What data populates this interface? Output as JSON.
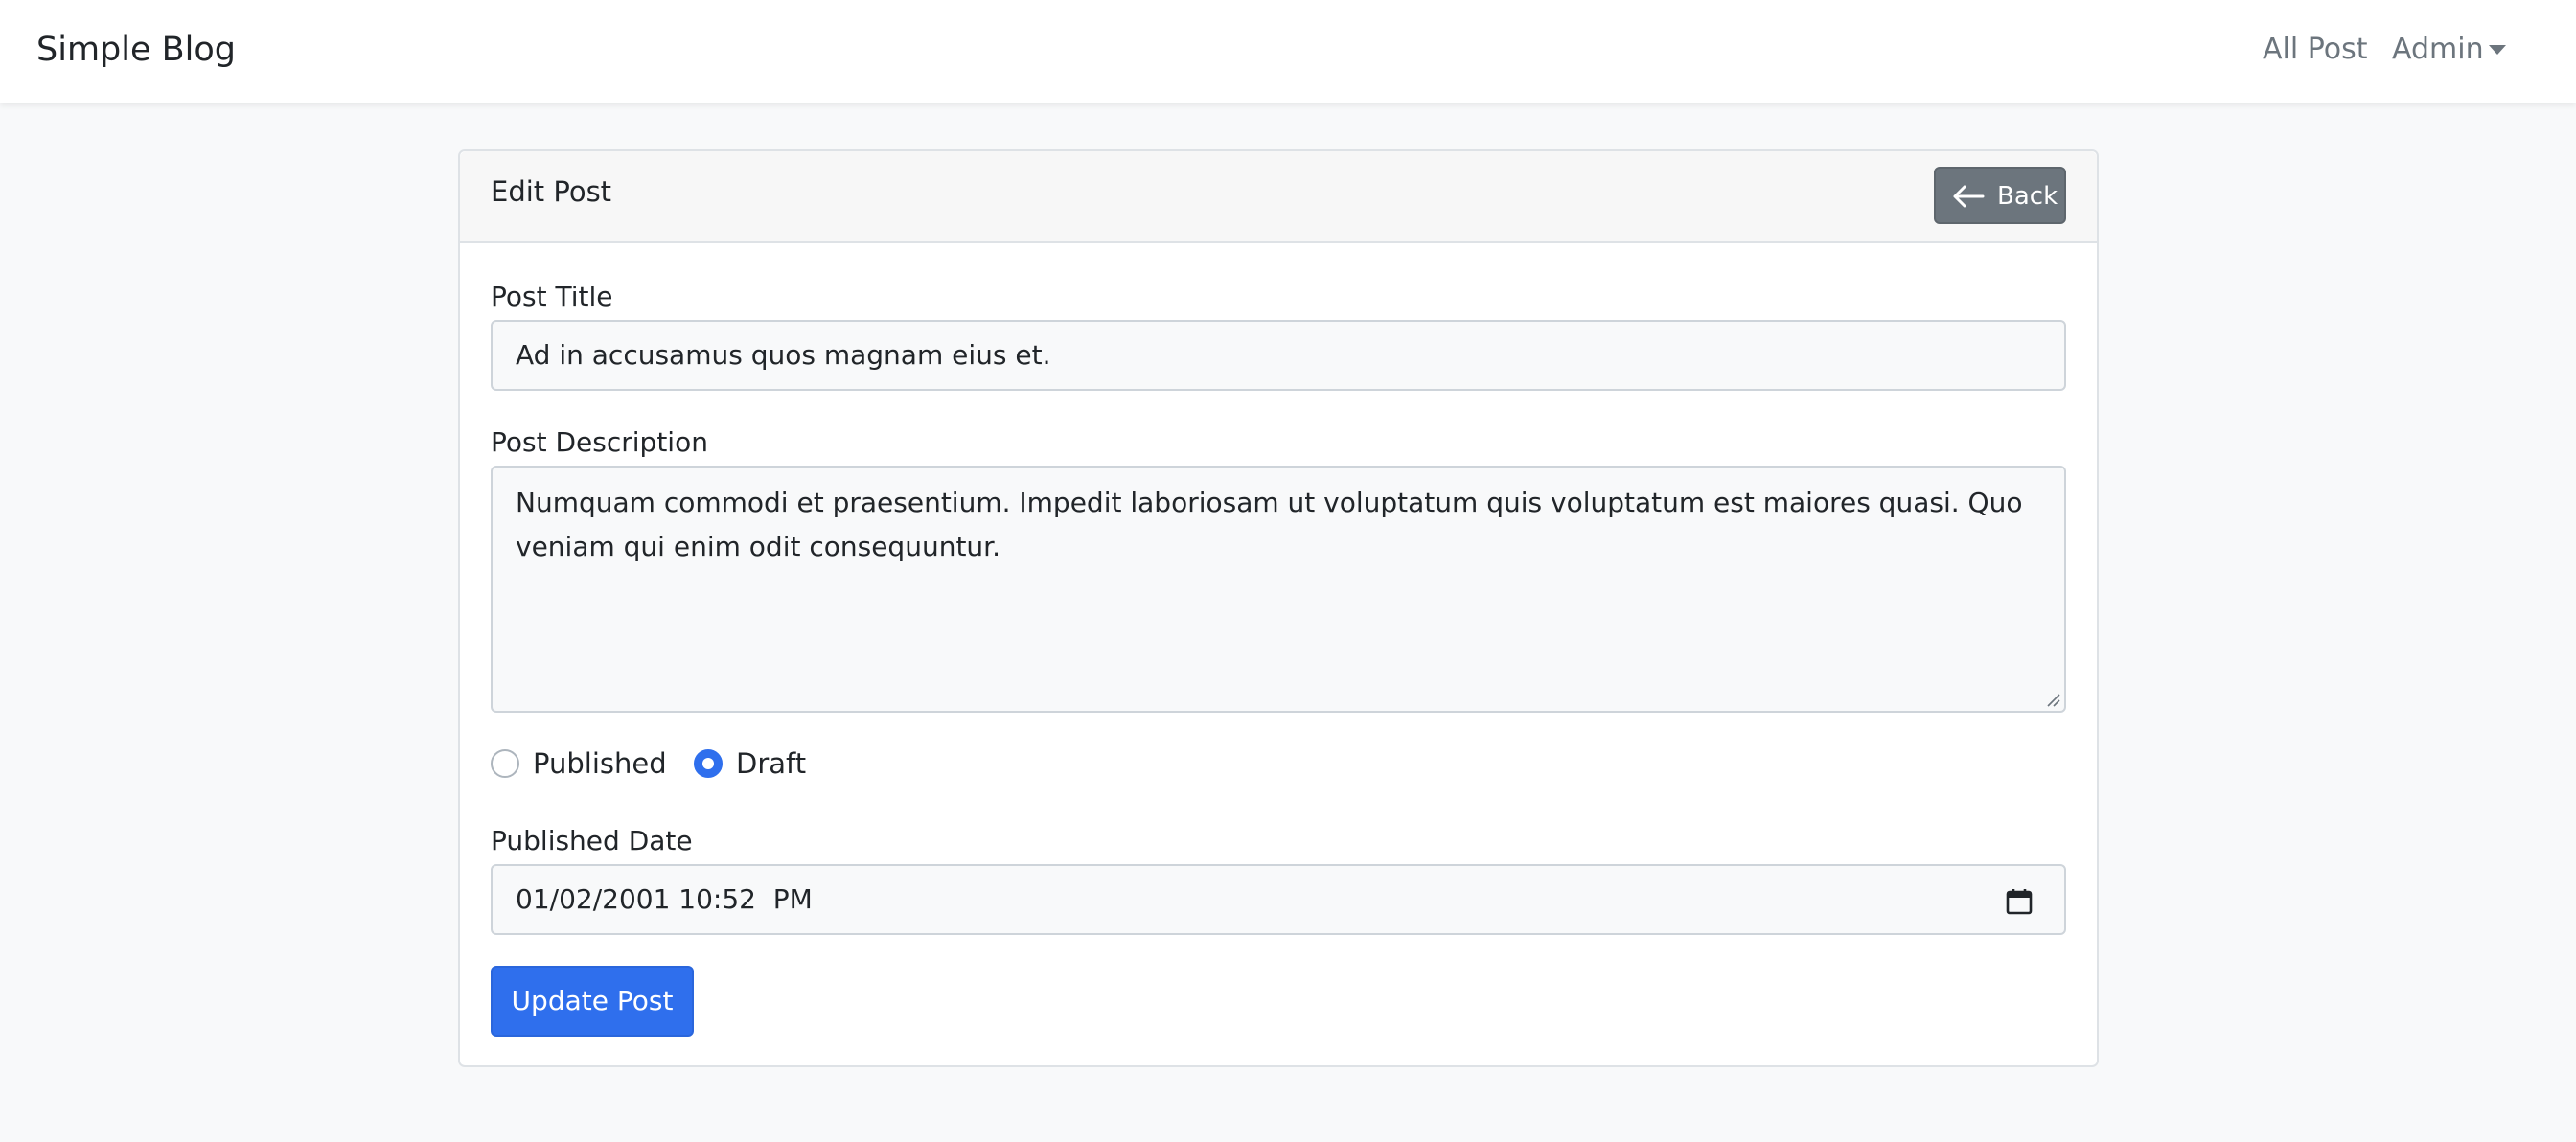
{
  "navbar": {
    "brand": "Simple Blog",
    "links": [
      {
        "label": "All Post"
      },
      {
        "label": "Admin",
        "icon": "caret-down-icon"
      }
    ]
  },
  "card": {
    "title": "Edit Post",
    "back_button": {
      "label": "Back",
      "icon": "arrow-left-icon"
    }
  },
  "form": {
    "title": {
      "label": "Post Title",
      "value": "Ad in accusamus quos magnam eius et."
    },
    "description": {
      "label": "Post Description",
      "value": "Numquam commodi et praesentium. Impedit laboriosam ut voluptatum quis voluptatum est maiores quasi. Quo veniam qui enim odit consequuntur."
    },
    "status": {
      "options": [
        {
          "label": "Published",
          "checked": false
        },
        {
          "label": "Draft",
          "checked": true
        }
      ]
    },
    "published_date": {
      "label": "Published Date",
      "value": "01/02/2001 10:52  PM",
      "icon": "calendar-icon"
    },
    "submit_label": "Update Post"
  },
  "colors": {
    "primary": "#2f6fed",
    "secondary": "#6c757d",
    "background": "#f8f9fa",
    "border": "#dee2e6"
  }
}
